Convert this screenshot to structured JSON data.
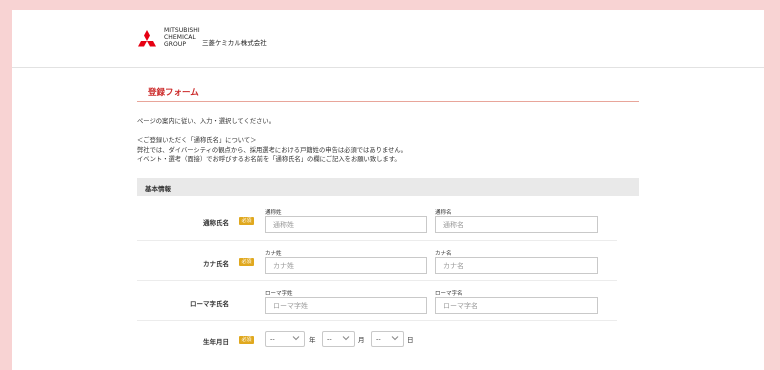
{
  "header": {
    "logo_lines": [
      "MITSUBISHI",
      "CHEMICAL",
      "GROUP"
    ],
    "company_jp": "三菱ケミカル株式会社",
    "brand_color": "#e60012"
  },
  "form": {
    "title": "登録フォーム",
    "intro": "ページの案内に従い、入力・選択してください。",
    "notice": [
      "＜ご登録いただく「通称氏名」について＞",
      "弊社では、ダイバーシティの観点から、採用選考における戸籍姓の申告は必須ではありません。",
      "イベント・選考（面接）でお呼びするお名前を「通称氏名」の欄にご記入をお願い致します。"
    ],
    "section_title": "基本情報",
    "required_badge": "必須",
    "required_color": "#e0a81e"
  },
  "rows": {
    "common_name": {
      "label": "通称氏名",
      "last_label": "通称姓",
      "last_placeholder": "通称姓",
      "first_label": "通称名",
      "first_placeholder": "通称名"
    },
    "kana_name": {
      "label": "カナ氏名",
      "last_label": "カナ姓",
      "last_placeholder": "カナ姓",
      "first_label": "カナ名",
      "first_placeholder": "カナ名"
    },
    "roman_name": {
      "label": "ローマ字氏名",
      "last_label": "ローマ字姓",
      "last_placeholder": "ローマ字姓",
      "first_label": "ローマ字名",
      "first_placeholder": "ローマ字名"
    },
    "birthdate": {
      "label": "生年月日",
      "year_value": "--",
      "year_unit": "年",
      "month_value": "--",
      "month_unit": "月",
      "day_value": "--",
      "day_unit": "日"
    }
  }
}
